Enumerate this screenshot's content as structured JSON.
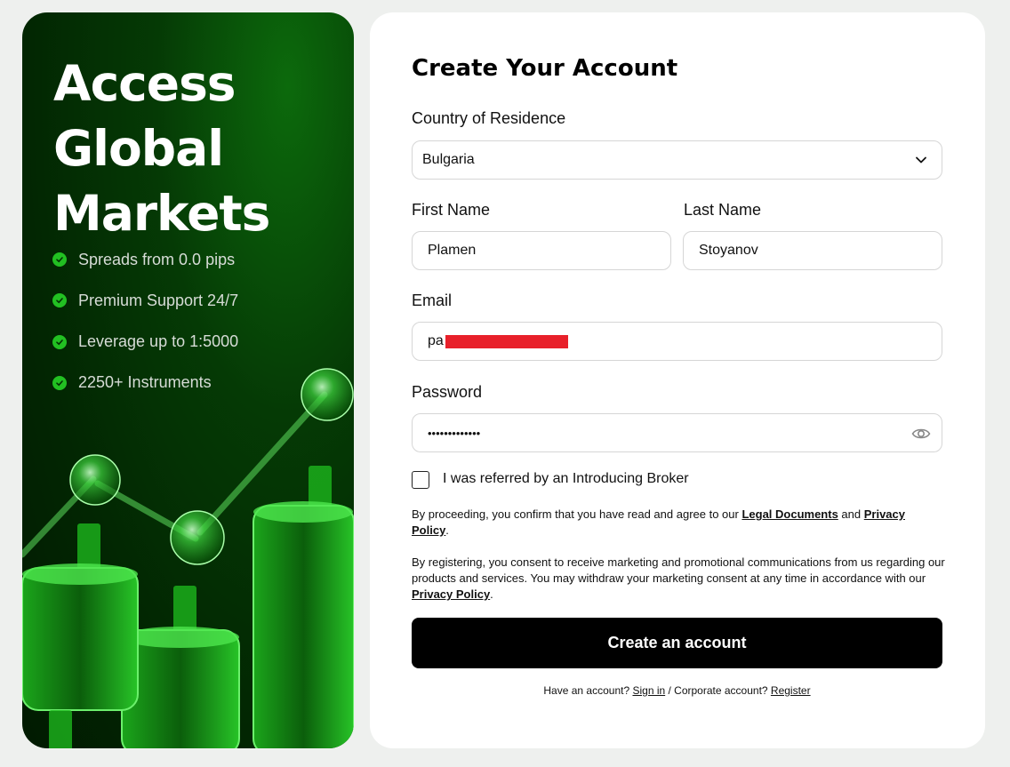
{
  "promo": {
    "title": "Access Global Markets",
    "features": [
      {
        "label": "Spreads from 0.0 pips"
      },
      {
        "label": "Premium Support 24/7"
      },
      {
        "label": "Leverage up to 1:5000"
      },
      {
        "label": "2250+ Instruments"
      }
    ]
  },
  "form": {
    "title": "Create Your Account",
    "country": {
      "label": "Country of Residence",
      "value": "Bulgaria"
    },
    "first_name": {
      "label": "First Name",
      "value": "Plamen"
    },
    "last_name": {
      "label": "Last Name",
      "value": "Stoyanov"
    },
    "email": {
      "label": "Email",
      "value": "pa"
    },
    "password": {
      "label": "Password",
      "value": "•••••••••••••"
    },
    "ib_checkbox": {
      "label": "I was referred by an Introducing Broker",
      "checked": false
    },
    "legal1": {
      "text1": "By proceeding, you confirm that you have read and agree to our ",
      "link1": "Legal Documents",
      "text2": " and ",
      "link2": "Privacy Policy",
      "text3": "."
    },
    "legal2": {
      "text1": "By registering, you consent to receive marketing and promotional communications from us regarding our products and services. You may withdraw your marketing consent at any time in accordance with our ",
      "link1": "Privacy Policy",
      "text2": "."
    },
    "submit_label": "Create an account",
    "footer": {
      "text1": "Have an account? ",
      "signin": "Sign in",
      "text2": " / Corporate account? ",
      "register": "Register"
    }
  },
  "colors": {
    "accent_green": "#22c022",
    "button_black": "#000000",
    "redaction_red": "#e8202a"
  }
}
